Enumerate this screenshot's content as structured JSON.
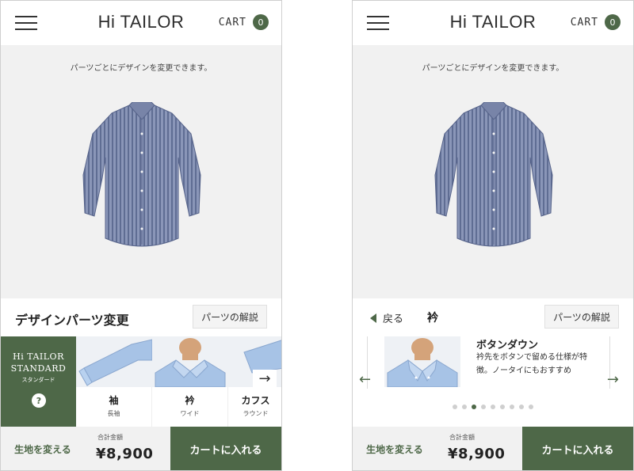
{
  "header": {
    "logo": "Hi TAILOR",
    "cart_label": "CART",
    "cart_count": "0"
  },
  "preview": {
    "note": "パーツごとにデザインを変更できます。"
  },
  "left": {
    "panel_title": "デザインパーツ変更",
    "guide_button": "パーツの解説",
    "standard": {
      "line1": "Hi TAILOR",
      "line2": "STANDARD",
      "sub": "スタンダード",
      "help": "?"
    },
    "parts": [
      {
        "label": "袖",
        "value": "長袖"
      },
      {
        "label": "衿",
        "value": "ワイド"
      },
      {
        "label": "カフス",
        "value": "ラウンド"
      }
    ],
    "next_arrow": "→"
  },
  "right": {
    "back_label": "戻る",
    "part_name": "衿",
    "guide_button": "パーツの解説",
    "option": {
      "title": "ボタンダウン",
      "description": "衿先をボタンで留める仕様が特徴。ノータイにもおすすめ"
    },
    "arrow_prev": "←",
    "arrow_next": "→",
    "dot_count": 9,
    "active_dot": 3
  },
  "footer": {
    "fabric_button": "生地を変える",
    "total_label": "合計金額",
    "total_value": "¥8,900",
    "cart_button": "カートに入れる"
  },
  "colors": {
    "accent": "#4e6848",
    "shirt": "#8793b5",
    "panel_bg": "#f1f1f1"
  }
}
